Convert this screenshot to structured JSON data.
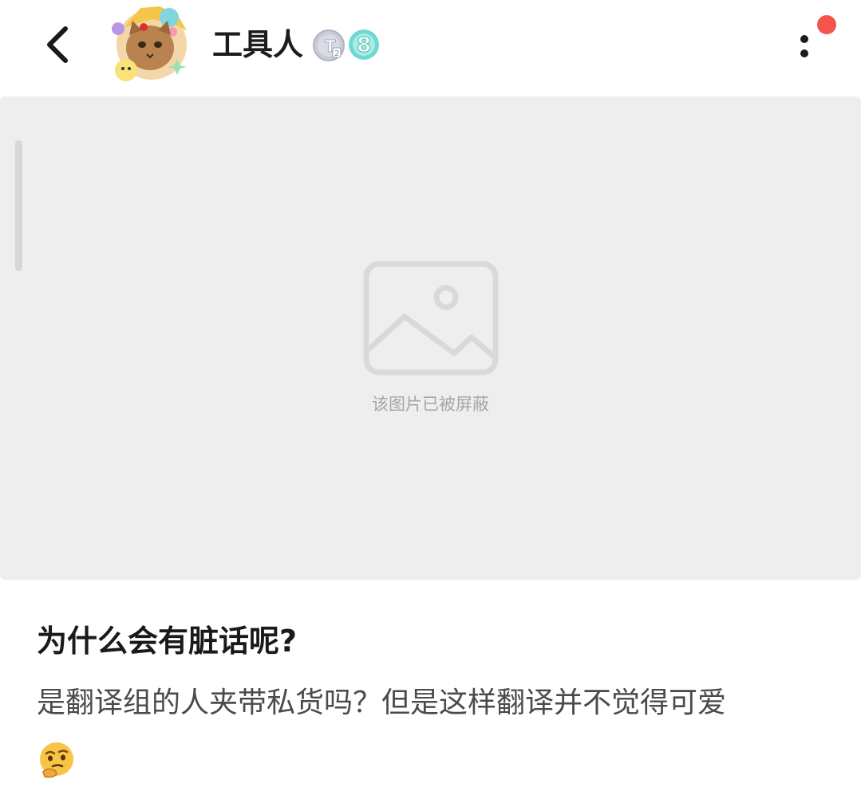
{
  "header": {
    "username": "工具人",
    "level": "8",
    "badge_letter": "T",
    "badge_sub": "2",
    "notification_color": "#f5544e"
  },
  "media": {
    "blocked_text": "该图片已被屏蔽",
    "background": "#eeeeee"
  },
  "post": {
    "title": "为什么会有脏话呢?",
    "body": "是翻译组的人夹带私货吗？但是这样翻译并不觉得可爱",
    "emoji": "thinking-face"
  },
  "icons": [
    "back-arrow-icon",
    "avatar",
    "tier-badge-icon",
    "level-badge-icon",
    "more-icon",
    "image-placeholder-icon",
    "thinking-emoji-icon"
  ]
}
